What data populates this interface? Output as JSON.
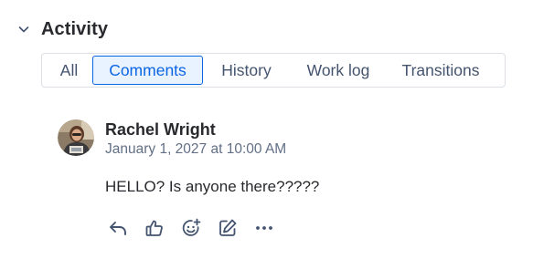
{
  "section": {
    "title": "Activity",
    "toggle_icon": "chevron-down-icon"
  },
  "tabs": [
    {
      "label": "All",
      "selected": false
    },
    {
      "label": "Comments",
      "selected": true
    },
    {
      "label": "History",
      "selected": false
    },
    {
      "label": "Work log",
      "selected": false
    },
    {
      "label": "Transitions",
      "selected": false
    }
  ],
  "comment": {
    "author": "Rachel Wright",
    "timestamp": "January 1, 2027 at 10:00 AM",
    "body": "HELLO? Is anyone there?????",
    "actions": [
      {
        "icon": "reply-icon"
      },
      {
        "icon": "like-icon"
      },
      {
        "icon": "add-reaction-icon"
      },
      {
        "icon": "edit-icon"
      },
      {
        "icon": "more-icon"
      }
    ]
  },
  "colors": {
    "accent": "#0c66e4",
    "accent_bg": "#e9f2ff",
    "text": "#292a2e",
    "subtle_text": "#626f86"
  }
}
